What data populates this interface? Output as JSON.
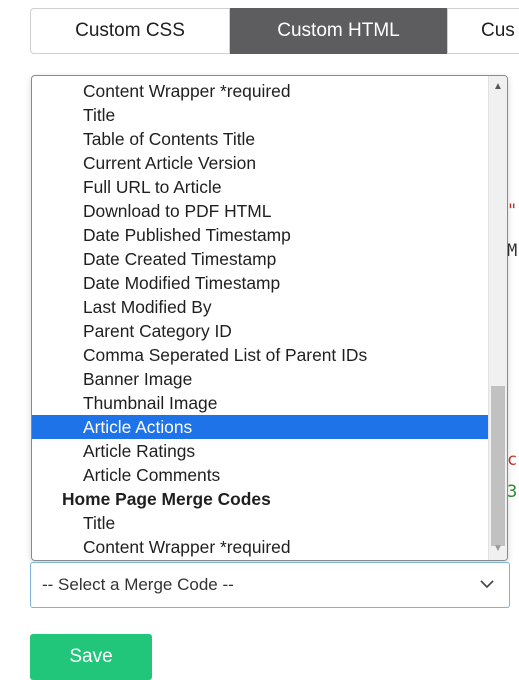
{
  "tabs": [
    {
      "label": "Custom CSS"
    },
    {
      "label": "Custom HTML"
    },
    {
      "label": "Cus"
    }
  ],
  "background": {
    "frag1": "\"",
    "frag2": "M",
    "frag3": "c",
    "frag4": "3"
  },
  "dropdown": {
    "options": [
      {
        "label": "Content Wrapper *required"
      },
      {
        "label": "Title"
      },
      {
        "label": "Table of Contents Title"
      },
      {
        "label": "Current Article Version"
      },
      {
        "label": "Full URL to Article"
      },
      {
        "label": "Download to PDF HTML"
      },
      {
        "label": "Date Published Timestamp"
      },
      {
        "label": "Date Created Timestamp"
      },
      {
        "label": "Date Modified Timestamp"
      },
      {
        "label": "Last Modified By"
      },
      {
        "label": "Parent Category ID"
      },
      {
        "label": "Comma Seperated List of Parent IDs"
      },
      {
        "label": "Banner Image"
      },
      {
        "label": "Thumbnail Image"
      },
      {
        "label": "Article Actions",
        "selected": true
      },
      {
        "label": "Article Ratings"
      },
      {
        "label": "Article Comments"
      }
    ],
    "group2": {
      "label": "Home Page Merge Codes",
      "options": [
        {
          "label": "Title"
        },
        {
          "label": "Content Wrapper *required"
        }
      ]
    }
  },
  "select": {
    "value": "-- Select a Merge Code --"
  },
  "save_label": "Save",
  "colors": {
    "active_tab": "#5d5d60",
    "selected_option": "#1e73e8",
    "save_button": "#21c67a",
    "select_border": "#7fb2d9"
  }
}
